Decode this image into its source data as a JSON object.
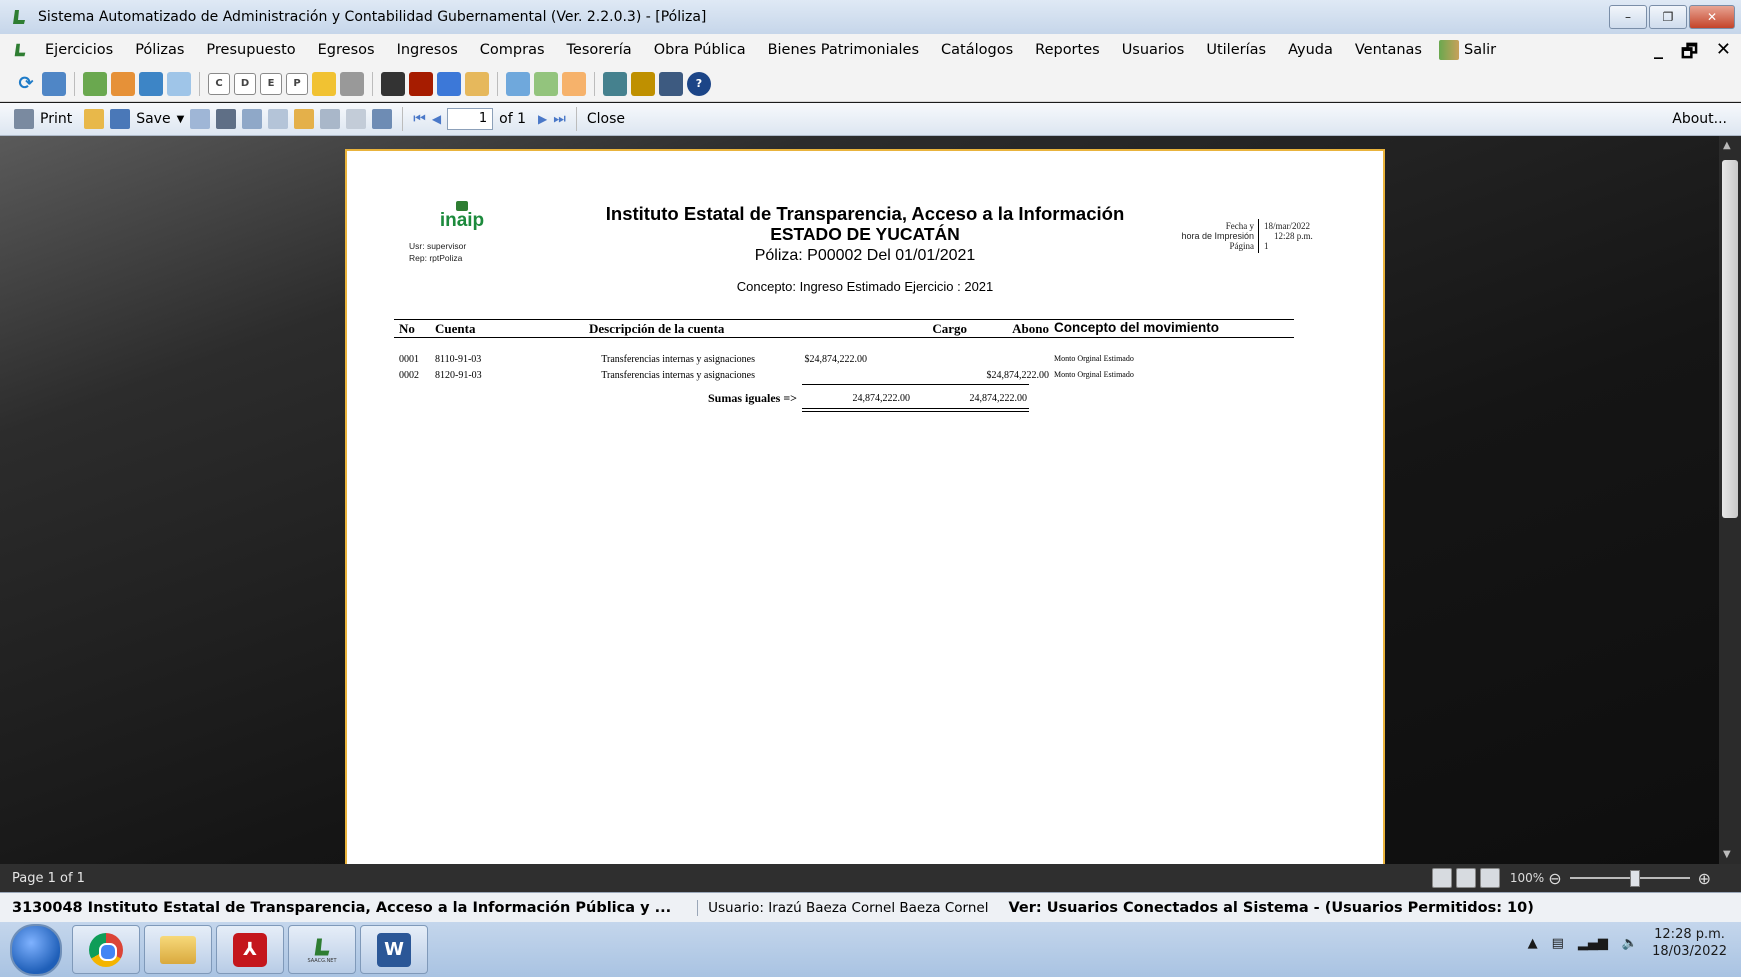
{
  "window": {
    "title": "Sistema Automatizado de Administración y Contabilidad Gubernamental  (Ver. 2.2.0.3) - [Póliza]",
    "buttons": {
      "minimize": "–",
      "restore": "❐",
      "close": "✕"
    }
  },
  "menu": {
    "items": [
      "Ejercicios",
      "Pólizas",
      "Presupuesto",
      "Egresos",
      "Ingresos",
      "Compras",
      "Tesorería",
      "Obra Pública",
      "Bienes Patrimoniales",
      "Catálogos",
      "Reportes",
      "Usuarios",
      "Utilerías",
      "Ayuda",
      "Ventanas",
      "Salir"
    ],
    "mdi": {
      "minimize": "_",
      "restore": "🗗",
      "close": "✕"
    }
  },
  "toolbar": {
    "letter_buttons": [
      "C",
      "D",
      "E",
      "P"
    ]
  },
  "report_toolbar": {
    "print": "Print",
    "save": "Save",
    "page_value": "1",
    "of_label": "of 1",
    "close": "Close",
    "about": "About..."
  },
  "report": {
    "logo_text": "inaip",
    "user_line": "Usr: supervisor",
    "rep_line": "Rep: rptPoliza",
    "title": "Instituto Estatal de Transparencia, Acceso a la Información",
    "subtitle": "ESTADO DE YUCATÁN",
    "poliza_line": "Póliza:  P00002  Del 01/01/2021",
    "concepto_line": "Concepto: Ingreso Estimado Ejercicio : 2021",
    "fecha_label": "Fecha y",
    "hora_label": "hora de Impresión",
    "pagina_label": "Página",
    "fecha_value": "18/mar/2022",
    "hora_value": "12:28 p.m.",
    "pagina_value": "1",
    "columns": {
      "no": "No",
      "cuenta": "Cuenta",
      "descripcion": "Descripción de la cuenta",
      "cargo": "Cargo",
      "abono": "Abono",
      "concepto": "Concepto del movimiento"
    },
    "rows": [
      {
        "no": "0001",
        "cuenta": "8110-91-03",
        "descripcion": "Transferencias internas y asignaciones",
        "cargo": "$24,874,222.00",
        "abono": "",
        "concepto": "Monto Orginal Estimado"
      },
      {
        "no": "0002",
        "cuenta": "8120-91-03",
        "descripcion": "Transferencias internas y asignaciones",
        "cargo": "",
        "abono": "$24,874,222.00",
        "concepto": "Monto Orginal Estimado"
      }
    ],
    "sumas_label": "Sumas iguales =>",
    "sum_cargo": "24,874,222.00",
    "sum_abono": "24,874,222.00"
  },
  "statusbar": {
    "page": "Page 1 of 1",
    "zoom": "100%"
  },
  "infobar": {
    "entity": "3130048 Instituto Estatal de Transparencia, Acceso a la Información Pública y ...",
    "user": "Usuario: Irazú Baeza Cornel Baeza Cornel",
    "version": "Ver: Usuarios Conectados al Sistema - (Usuarios Permitidos: 10)"
  },
  "taskbar": {
    "time": "12:28 p.m.",
    "date": "18/03/2022",
    "saacg_label": "SAACG.NET"
  }
}
